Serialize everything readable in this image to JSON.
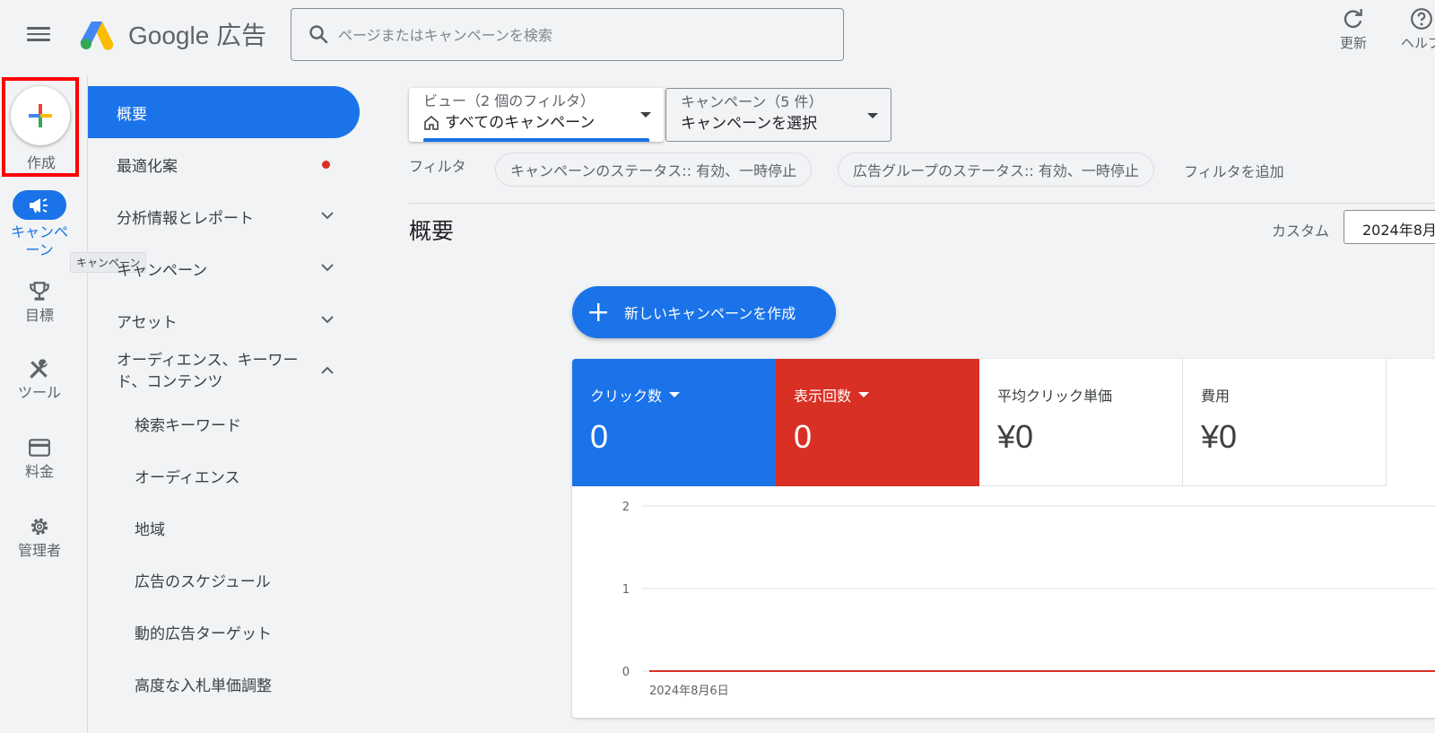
{
  "header": {
    "brand": "Google 広告",
    "search_placeholder": "ページまたはキャンペーンを検索",
    "refresh_label": "更新",
    "help_label": "ヘルプ"
  },
  "rail": {
    "create_label": "作成",
    "items": [
      {
        "label": "キャンペーン",
        "icon": "megaphone-icon",
        "active": true
      },
      {
        "label": "目標",
        "icon": "trophy-icon"
      },
      {
        "label": "ツール",
        "icon": "tools-icon"
      },
      {
        "label": "料金",
        "icon": "credit-card-icon"
      },
      {
        "label": "管理者",
        "icon": "gear-icon"
      }
    ],
    "tooltip": "キャンペーン"
  },
  "nav": {
    "items": [
      {
        "label": "概要",
        "selected": true
      },
      {
        "label": "最適化案",
        "badge": "red-dot"
      },
      {
        "label": "分析情報とレポート",
        "expandable": true
      },
      {
        "label": "キャンペーン",
        "expandable": true
      },
      {
        "label": "アセット",
        "expandable": true
      },
      {
        "label": "オーディエンス、キーワード、コンテンツ",
        "line1": "オーディエンス、キーワー",
        "line2": "ド、コンテンツ",
        "expanded": true
      }
    ],
    "subitems": [
      "検索キーワード",
      "オーディエンス",
      "地域",
      "広告のスケジュール",
      "動的広告ターゲット",
      "高度な入札単価調整"
    ]
  },
  "main": {
    "view_dropdown": {
      "label": "ビュー（2 個のフィルタ）",
      "value": "すべてのキャンペーン"
    },
    "campaign_dropdown": {
      "label": "キャンペーン（5 件）",
      "value": "キャンペーンを選択"
    },
    "filter_label": "フィルタ",
    "filters": [
      "キャンペーンのステータス:: 有効、一時停止",
      "広告グループのステータス:: 有効、一時停止"
    ],
    "add_filter": "フィルタを追加",
    "page_title": "概要",
    "date_label": "カスタム",
    "date_value": "2024年8月",
    "new_campaign_button": "新しいキャンペーンを作成"
  },
  "metrics": [
    {
      "label": "クリック数",
      "value": "0",
      "color": "#1a73e8"
    },
    {
      "label": "表示回数",
      "value": "0",
      "color": "#d93025"
    },
    {
      "label": "平均クリック単価",
      "value": "¥0"
    },
    {
      "label": "費用",
      "value": "¥0"
    }
  ],
  "chart_data": {
    "type": "line",
    "x": [
      "2024年8月6日"
    ],
    "series": [
      {
        "values": [
          0
        ],
        "color": "#d93025"
      }
    ],
    "y_ticks": [
      "0",
      "1",
      "2"
    ],
    "ylim": [
      0,
      2
    ],
    "grid": true
  }
}
